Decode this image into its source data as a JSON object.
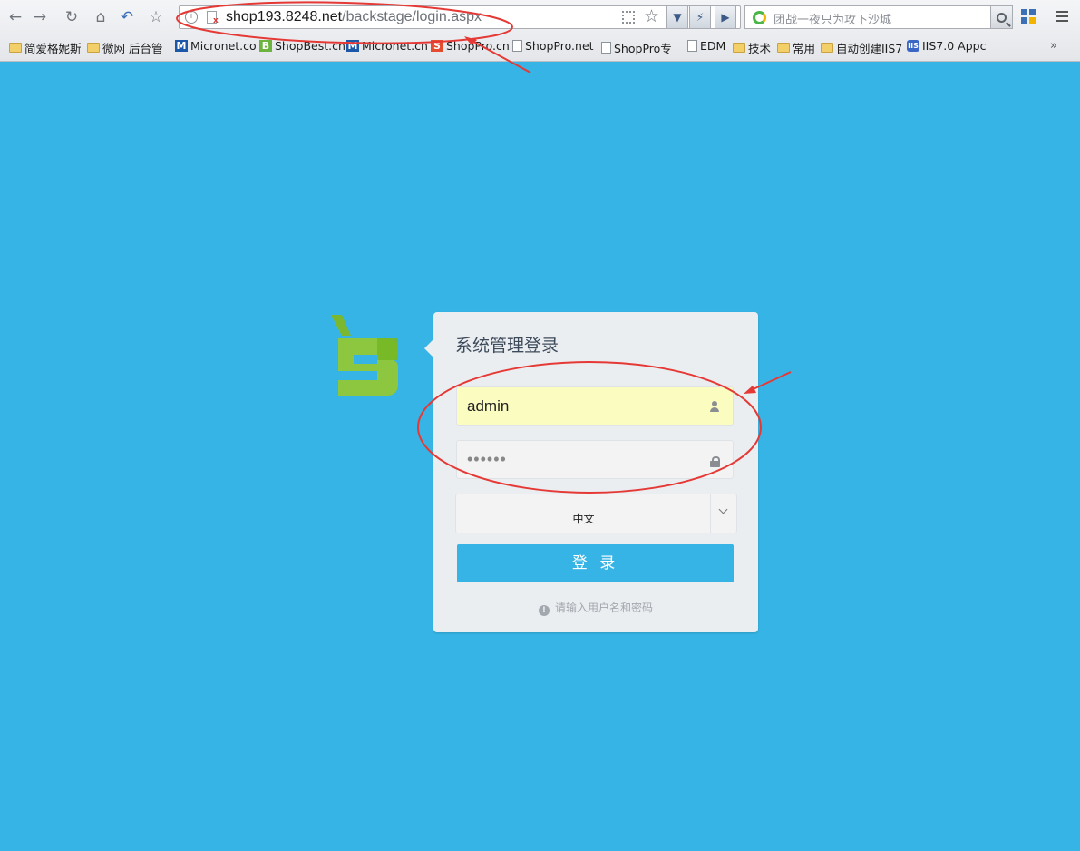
{
  "browser": {
    "url_host": "shop193.8248.net",
    "url_path": "/backstage/login.aspx",
    "search_placeholder": "团战一夜只为攻下沙城",
    "bookmarks": [
      {
        "label": "简爱格妮斯",
        "icon": "folder-icon"
      },
      {
        "label": "微网 后台管",
        "icon": "folder-icon"
      },
      {
        "label": "Micronet.co",
        "icon": "m-logo-icon",
        "glyph": "M"
      },
      {
        "label": "ShopBest.cn",
        "icon": "b-logo-icon",
        "glyph": "B"
      },
      {
        "label": "Micronet.cn",
        "icon": "m-logo-icon",
        "glyph": "M"
      },
      {
        "label": "ShopPro.cn",
        "icon": "s-logo-icon",
        "glyph": "S"
      },
      {
        "label": "ShopPro.net",
        "icon": "page-icon"
      },
      {
        "label": "ShopPro专",
        "icon": "page-icon"
      },
      {
        "label": "EDM",
        "icon": "page-icon"
      },
      {
        "label": "技术",
        "icon": "folder-icon"
      },
      {
        "label": "常用",
        "icon": "folder-icon"
      },
      {
        "label": "自动创建IIS7",
        "icon": "folder-icon"
      },
      {
        "label": "IIS7.0 Appc",
        "icon": "iis-icon",
        "glyph": "IIS"
      }
    ],
    "more": "»"
  },
  "login": {
    "title": "系统管理登录",
    "username_value": "admin",
    "password_value": "••••••",
    "language_value": "中文",
    "submit_label": "登 录",
    "hint_text": "请输入用户名和密码",
    "hint_icon": "!"
  },
  "colors": {
    "background": "#36b4e5",
    "panel": "#ebeef1",
    "annotation": "#e53935",
    "logo_green": "#8dc63f",
    "username_bg": "#fbfcc0"
  }
}
